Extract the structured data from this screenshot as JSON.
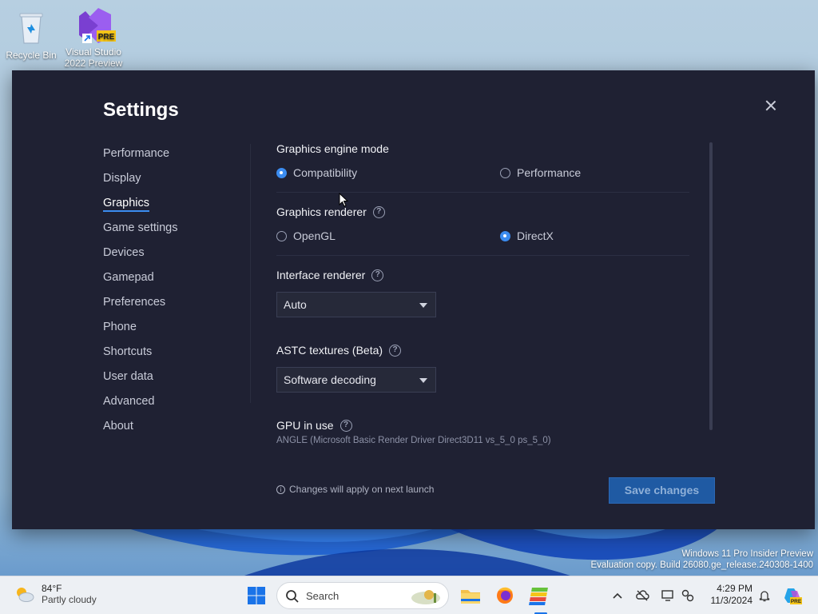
{
  "desktop": {
    "icons": [
      {
        "label": "Recycle Bin"
      },
      {
        "label": "Visual Studio 2022 Preview"
      }
    ],
    "watermark": {
      "line1": "Windows 11 Pro Insider Preview",
      "line2": "Evaluation copy. Build 26080.ge_release.240308-1400"
    }
  },
  "settings": {
    "title": "Settings",
    "nav": [
      {
        "label": "Performance"
      },
      {
        "label": "Display"
      },
      {
        "label": "Graphics",
        "active": true
      },
      {
        "label": "Game settings"
      },
      {
        "label": "Devices"
      },
      {
        "label": "Gamepad"
      },
      {
        "label": "Preferences"
      },
      {
        "label": "Phone"
      },
      {
        "label": "Shortcuts"
      },
      {
        "label": "User data"
      },
      {
        "label": "Advanced"
      },
      {
        "label": "About"
      }
    ],
    "graphics_engine_mode": {
      "label": "Graphics engine mode",
      "options": [
        {
          "label": "Compatibility",
          "selected": true
        },
        {
          "label": "Performance",
          "selected": false
        }
      ]
    },
    "graphics_renderer": {
      "label": "Graphics renderer",
      "options": [
        {
          "label": "OpenGL",
          "selected": false
        },
        {
          "label": "DirectX",
          "selected": true
        }
      ]
    },
    "interface_renderer": {
      "label": "Interface renderer",
      "value": "Auto"
    },
    "astc_textures": {
      "label": "ASTC textures (Beta)",
      "value": "Software decoding"
    },
    "gpu_in_use": {
      "label": "GPU in use",
      "value": "ANGLE (Microsoft Basic Render Driver Direct3D11 vs_5_0 ps_5_0)"
    },
    "footer_note": "Changes will apply on next launch",
    "save_label": "Save changes"
  },
  "taskbar": {
    "weather": {
      "temp": "84°F",
      "condition": "Partly cloudy"
    },
    "search_placeholder": "Search",
    "clock": {
      "time": "4:29 PM",
      "date": "11/3/2024"
    }
  },
  "colors": {
    "window_bg": "#1f2133",
    "accent": "#3b8cf0",
    "save_button": "#1f5aa3"
  }
}
